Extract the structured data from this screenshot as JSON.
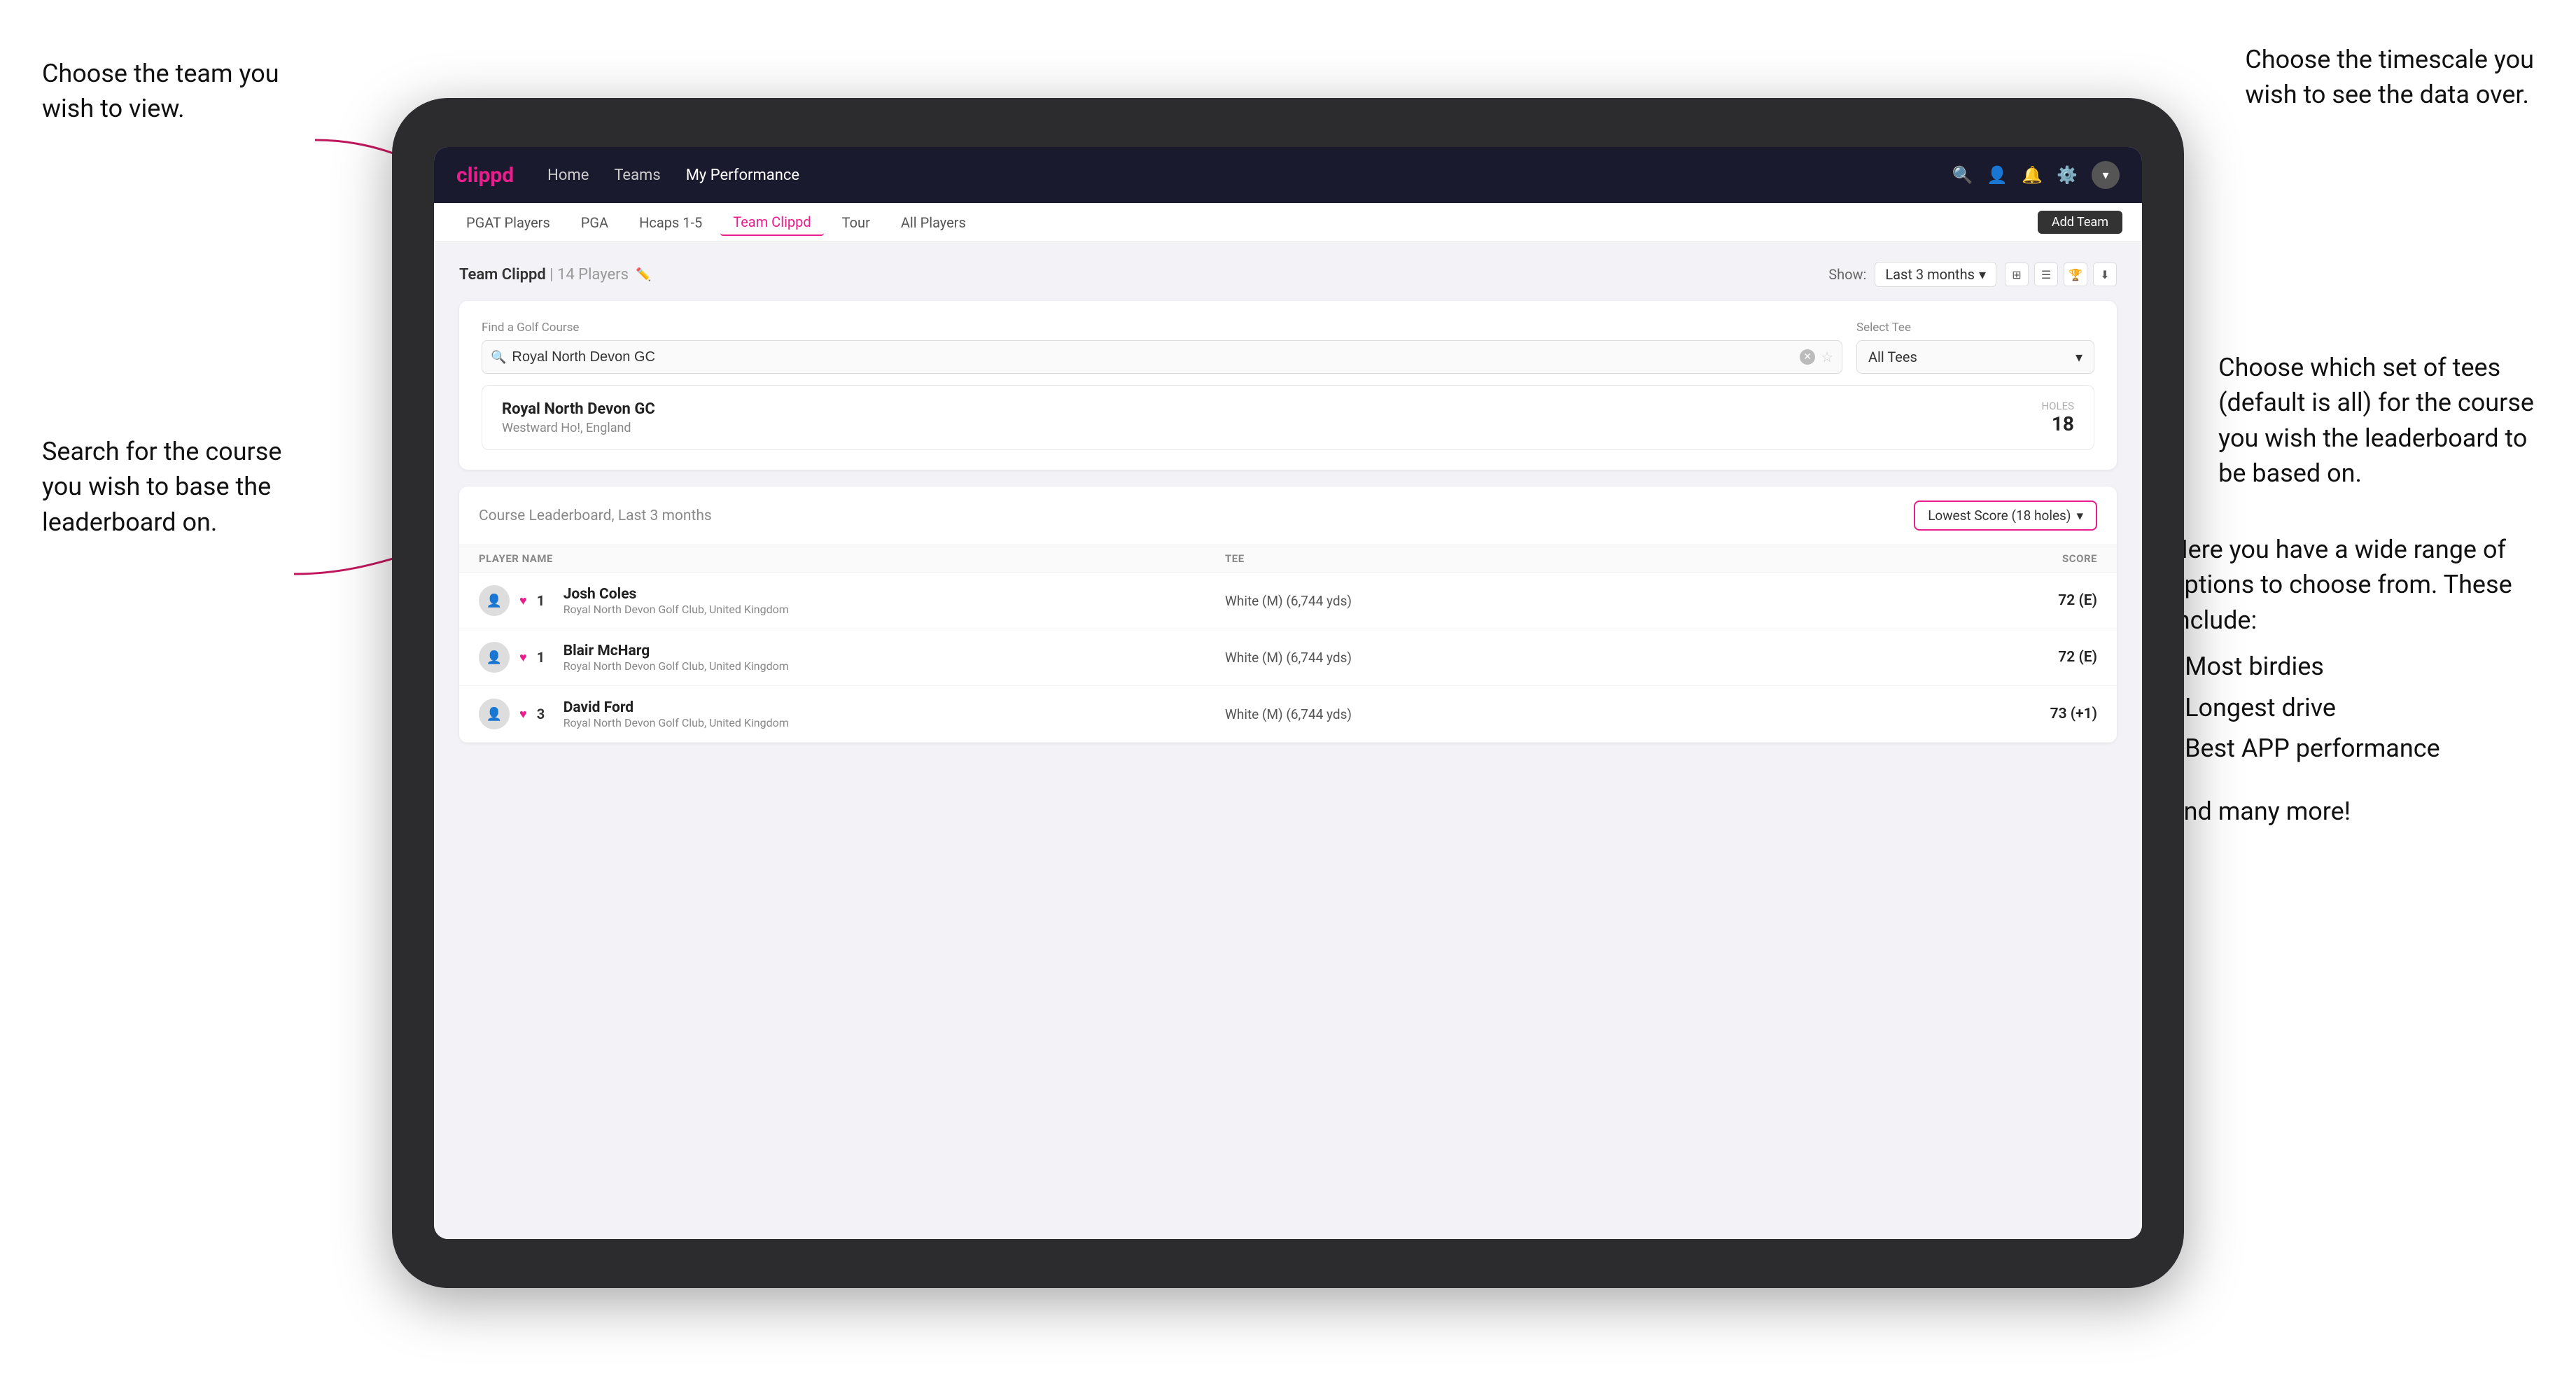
{
  "annotations": {
    "top_left": {
      "line1": "Choose the team you",
      "line2": "wish to view."
    },
    "bottom_left": {
      "line1": "Search for the course",
      "line2": "you wish to base the",
      "line3": "leaderboard on."
    },
    "top_right": {
      "line1": "Choose the timescale you",
      "line2": "wish to see the data over."
    },
    "mid_right": {
      "line1": "Choose which set of tees",
      "line2": "(default is all) for the course",
      "line3": "you wish the leaderboard to",
      "line4": "be based on."
    },
    "bottom_right": {
      "intro": "Here you have a wide range of options to choose from. These include:",
      "bullets": [
        "Most birdies",
        "Longest drive",
        "Best APP performance"
      ],
      "ending": "and many more!"
    }
  },
  "navbar": {
    "logo": "clippd",
    "links": [
      "Home",
      "Teams",
      "My Performance"
    ],
    "active_link": "My Performance",
    "icons": [
      "search",
      "person",
      "bell",
      "settings",
      "avatar"
    ]
  },
  "subnav": {
    "items": [
      "PGAT Players",
      "PGA",
      "Hcaps 1-5",
      "Team Clippd",
      "Tour",
      "All Players"
    ],
    "active_item": "Team Clippd",
    "add_button": "Add Team"
  },
  "team_header": {
    "title": "Team Clippd",
    "player_count": "14 Players",
    "show_label": "Show:",
    "show_value": "Last 3 months"
  },
  "course_search": {
    "find_label": "Find a Golf Course",
    "search_placeholder": "Royal North Devon GC",
    "search_value": "Royal North Devon GC",
    "select_tee_label": "Select Tee",
    "tee_value": "All Tees"
  },
  "course_result": {
    "name": "Royal North Devon GC",
    "location": "Westward Ho!, England",
    "holes_label": "Holes",
    "holes_count": "18"
  },
  "leaderboard": {
    "title": "Course Leaderboard,",
    "period": "Last 3 months",
    "score_option": "Lowest Score (18 holes)",
    "columns": {
      "player_name": "PLAYER NAME",
      "tee": "TEE",
      "score": "SCORE"
    },
    "rows": [
      {
        "rank": "1",
        "name": "Josh Coles",
        "club": "Royal North Devon Golf Club, United Kingdom",
        "tee": "White (M) (6,744 yds)",
        "score": "72 (E)"
      },
      {
        "rank": "1",
        "name": "Blair McHarg",
        "club": "Royal North Devon Golf Club, United Kingdom",
        "tee": "White (M) (6,744 yds)",
        "score": "72 (E)"
      },
      {
        "rank": "3",
        "name": "David Ford",
        "club": "Royal North Devon Golf Club, United Kingdom",
        "tee": "White (M) (6,744 yds)",
        "score": "73 (+1)"
      }
    ]
  }
}
